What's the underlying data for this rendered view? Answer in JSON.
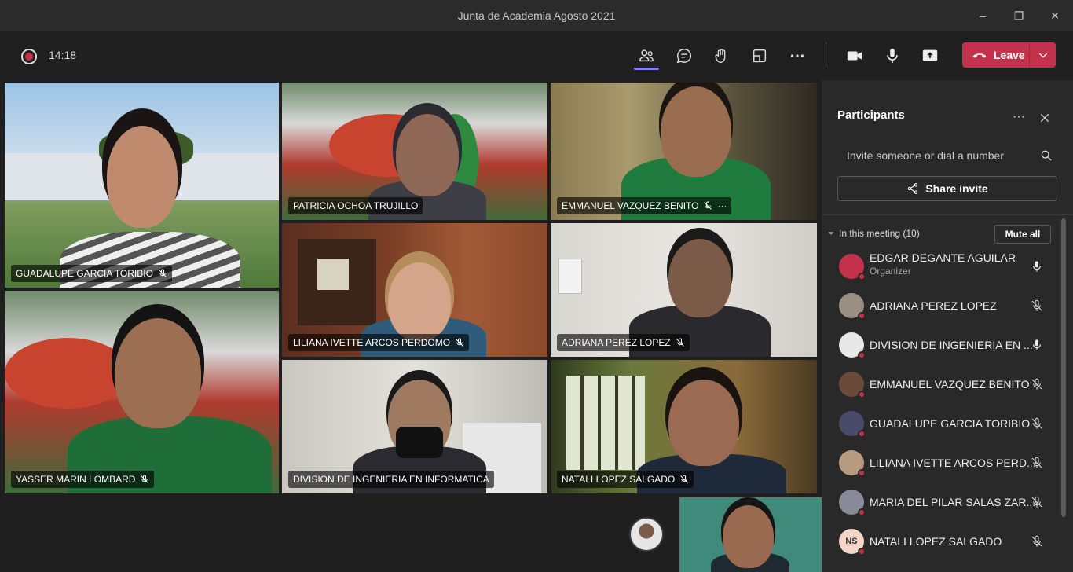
{
  "window": {
    "title": "Junta de Academia Agosto 2021",
    "controls": [
      "–",
      "❐",
      "✕"
    ]
  },
  "toolbar": {
    "timer": "14:18",
    "leave_label": "Leave"
  },
  "tiles": [
    {
      "name": "GUADALUPE GARCIA TORIBIO",
      "muted": true
    },
    {
      "name": "PATRICIA OCHOA TRUJILLO",
      "muted": false
    },
    {
      "name": "EMMANUEL VAZQUEZ BENITO",
      "muted": true,
      "more": "···"
    },
    {
      "name": "LILIANA IVETTE ARCOS PERDOMO",
      "muted": true
    },
    {
      "name": "ADRIANA PEREZ LOPEZ",
      "muted": true
    },
    {
      "name": "YASSER MARIN LOMBARD",
      "muted": true
    },
    {
      "name": "DIVISION DE INGENIERIA EN INFORMATICA",
      "muted": false
    },
    {
      "name": "NATALI LOPEZ SALGADO",
      "muted": true
    }
  ],
  "panel": {
    "title": "Participants",
    "more": "···",
    "invite_placeholder": "Invite someone or dial a number",
    "share_label": "Share invite",
    "in_meeting_label": "In this meeting (10)",
    "mute_all_label": "Mute all",
    "participants": [
      {
        "name": "EDGAR DEGANTE AGUILAR",
        "role": "Organizer",
        "mic": "on",
        "avatar_color": "#c4314b"
      },
      {
        "name": "ADRIANA PEREZ LOPEZ",
        "role": "",
        "mic": "off",
        "avatar_color": "#9a8f80"
      },
      {
        "name": "DIVISION DE INGENIERIA EN ...",
        "role": "",
        "mic": "on",
        "avatar_color": "#e8e8e8"
      },
      {
        "name": "EMMANUEL VAZQUEZ BENITO",
        "role": "",
        "mic": "off",
        "avatar_color": "#6b4a3a"
      },
      {
        "name": "GUADALUPE GARCIA TORIBIO",
        "role": "",
        "mic": "off",
        "avatar_color": "#4a4a6a"
      },
      {
        "name": "LILIANA IVETTE ARCOS PERD...",
        "role": "",
        "mic": "off",
        "avatar_color": "#b89a80"
      },
      {
        "name": "MARIA DEL PILAR SALAS ZAR...",
        "role": "",
        "mic": "off",
        "avatar_color": "#8a8a9a"
      },
      {
        "name": "NATALI LOPEZ SALGADO",
        "role": "",
        "mic": "off",
        "avatar_color": "#f4d6c8",
        "initials": "NS"
      }
    ]
  }
}
